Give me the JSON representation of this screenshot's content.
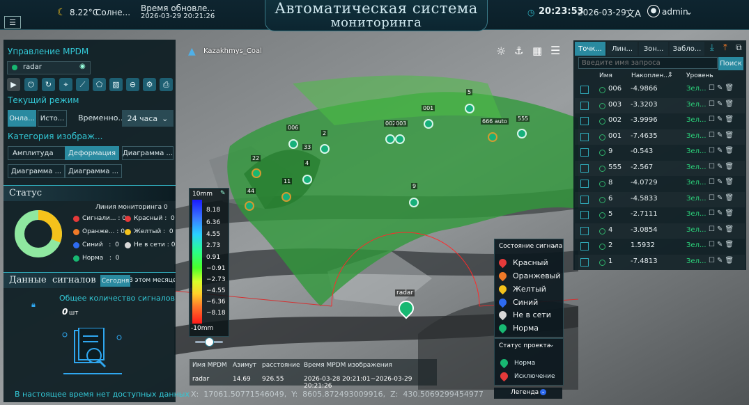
{
  "header": {
    "weather_temp": "8.22°C",
    "weather_desc": "Солне...",
    "update_label": "Время обновле...",
    "update_time": "2026-03-29 20:21:26",
    "title_line1": "Автоматическая  система",
    "title_line2": "мониторинга",
    "clock": "20:23:53",
    "date": "2026-03-29",
    "user": "admin"
  },
  "map": {
    "project_name": "Kazakhmys_Coal",
    "coords": "X:  17061.50771546049,  Y:  8605.872493009916,  Z:  430.5069299454977",
    "radar_label": "radar",
    "markers": [
      {
        "label": "006"
      },
      {
        "label": "2"
      },
      {
        "label": "33"
      },
      {
        "label": "22"
      },
      {
        "label": "4"
      },
      {
        "label": "11"
      },
      {
        "label": "44"
      },
      {
        "label": "002"
      },
      {
        "label": "003"
      },
      {
        "label": "001"
      },
      {
        "label": "5"
      },
      {
        "label": "666 auto"
      },
      {
        "label": "555"
      },
      {
        "label": "9"
      }
    ]
  },
  "colorbar": {
    "top": "10mm",
    "bottom": "-10mm",
    "ticks": [
      "8.18",
      "6.36",
      "4.55",
      "2.73",
      "0.91",
      "−0.91",
      "−2.73",
      "−4.55",
      "−6.36",
      "−8.18"
    ]
  },
  "left": {
    "mpdm_title": "Управление MPDM",
    "radar_select": "radar",
    "mode_title": "Текущий режим",
    "mode_online": "Онла...",
    "mode_history": "Исто...",
    "time_label": "Временно...",
    "time_value": "24 часа",
    "category_title": "Категория изображ...",
    "cat_buttons": [
      "Амплитуда",
      "Деформация",
      "Диаграмма ...",
      "Диаграмма ...",
      "Диаграмма ..."
    ],
    "status_title": "Статус",
    "status_line": "Линия мониторинга 0",
    "status_items": [
      {
        "name": "Сигнали...",
        "count": "0",
        "color": "#e53a3a"
      },
      {
        "name": "Красный",
        "count": "0",
        "color": "#e53a3a"
      },
      {
        "name": "Оранже...",
        "count": "0",
        "color": "#f07a28"
      },
      {
        "name": "Желтый",
        "count": "0",
        "color": "#f5c21b"
      },
      {
        "name": "Синий",
        "count": "0",
        "color": "#2e6bf0"
      },
      {
        "name": "Не в сети",
        "count": "0",
        "color": "#d8d8d8"
      },
      {
        "name": "Норма",
        "count": "0",
        "color": "#18b872"
      }
    ],
    "signals_title": "Данные  сигналов",
    "tab_today": "Сегодня",
    "tab_month": "В этом месяце",
    "total_label": "Общее количество сигналов",
    "total_value": "0",
    "total_unit": "шт",
    "no_data": "В настоящее время нет доступных данных"
  },
  "info_table": {
    "headers": [
      "Имя MPDM",
      "Азимут",
      "расстояние",
      "Время MPDM изображения"
    ],
    "row": [
      "radar",
      "14.69",
      "926.55",
      "2026-03-28 20:21:01~2026-03-29 20:21:26"
    ]
  },
  "signal_legend": {
    "title": "Состояние сигнала",
    "items": [
      {
        "name": "Красный",
        "color": "#e53a3a"
      },
      {
        "name": "Оранжевый",
        "color": "#f07a28"
      },
      {
        "name": "Желтый",
        "color": "#f5c21b"
      },
      {
        "name": "Синий",
        "color": "#2e6bf0"
      },
      {
        "name": "Не в сети",
        "color": "#d8d8d8"
      },
      {
        "name": "Норма",
        "color": "#18b872"
      }
    ],
    "project_title": "Статус проекта",
    "project_items": [
      {
        "name": "Норма",
        "color": "#18b872"
      },
      {
        "name": "Исключение",
        "color": "#e53a3a"
      }
    ],
    "legend_label": "Легенда"
  },
  "right": {
    "tabs": [
      "Точк...",
      "Лин...",
      "Зон...",
      "Забло..."
    ],
    "search_placeholder": "Введите имя запроса",
    "search_button": "Поиск",
    "col_name": "Имя",
    "col_accum": "Накоплен...",
    "col_level": "Уровень",
    "rows": [
      {
        "name": "006",
        "value": "-4.9866",
        "level": "Зел..."
      },
      {
        "name": "003",
        "value": "-3.3203",
        "level": "Зел..."
      },
      {
        "name": "002",
        "value": "-3.9996",
        "level": "Зел..."
      },
      {
        "name": "001",
        "value": "-7.4635",
        "level": "Зел..."
      },
      {
        "name": "9",
        "value": "-0.543",
        "level": "Зел..."
      },
      {
        "name": "555",
        "value": "-2.567",
        "level": "Зел..."
      },
      {
        "name": "8",
        "value": "-4.0729",
        "level": "Зел..."
      },
      {
        "name": "6",
        "value": "-4.5833",
        "level": "Зел..."
      },
      {
        "name": "5",
        "value": "-2.7111",
        "level": "Зел..."
      },
      {
        "name": "4",
        "value": "-3.0854",
        "level": "Зел..."
      },
      {
        "name": "2",
        "value": "1.5932",
        "level": "Зел..."
      },
      {
        "name": "1",
        "value": "-7.4813",
        "level": "Зел..."
      }
    ]
  },
  "colors": {
    "accent": "#2a8aa0",
    "normal": "#18b872",
    "panel": "#0c1c22"
  }
}
